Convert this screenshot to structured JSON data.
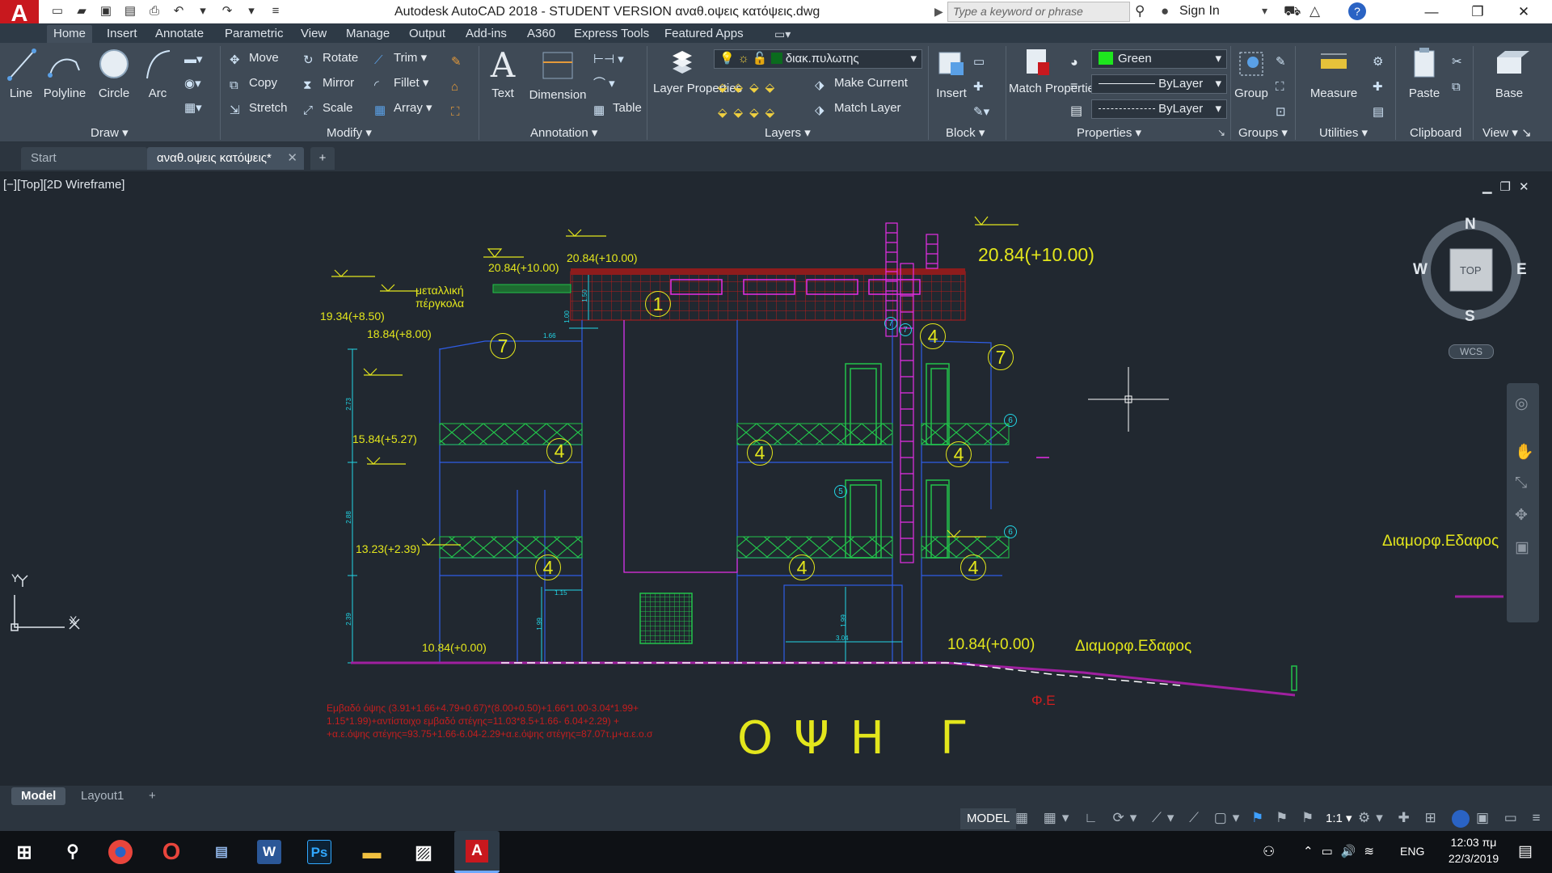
{
  "app": {
    "title": "Autodesk AutoCAD 2018 - STUDENT VERSION    αναθ.οψεις κατόψεις.dwg",
    "logo": "A",
    "search_placeholder": "Type a keyword or phrase",
    "sign_in": "Sign In"
  },
  "ribbon_tabs": [
    "Home",
    "Insert",
    "Annotate",
    "Parametric",
    "View",
    "Manage",
    "Output",
    "Add-ins",
    "A360",
    "Express Tools",
    "Featured Apps"
  ],
  "ribbon": {
    "draw": {
      "line": "Line",
      "polyline": "Polyline",
      "circle": "Circle",
      "arc": "Arc",
      "caption": "Draw"
    },
    "modify": {
      "move": "Move",
      "rotate": "Rotate",
      "trim": "Trim",
      "copy": "Copy",
      "mirror": "Mirror",
      "fillet": "Fillet",
      "stretch": "Stretch",
      "scale": "Scale",
      "array": "Array",
      "caption": "Modify"
    },
    "annotation": {
      "text": "Text",
      "dimension": "Dimension",
      "table": "Table",
      "caption": "Annotation"
    },
    "layers": {
      "layer_properties": "Layer Properties",
      "current_layer": "διακ.πυλωτης",
      "make_current": "Make Current",
      "match_layer": "Match Layer",
      "caption": "Layers"
    },
    "block": {
      "insert": "Insert",
      "caption": "Block"
    },
    "properties": {
      "match_properties": "Match Properties",
      "color": "Green",
      "linetype": "ByLayer",
      "lineweight": "ByLayer",
      "caption": "Properties"
    },
    "groups": {
      "group": "Group",
      "caption": "Groups"
    },
    "utilities": {
      "measure": "Measure",
      "caption": "Utilities"
    },
    "clipboard": {
      "paste": "Paste",
      "caption": "Clipboard"
    },
    "view": {
      "base": "Base",
      "caption": "View"
    }
  },
  "doc_tabs": {
    "start": "Start",
    "active": "αναθ.οψεις κατόψεις*",
    "add": "+"
  },
  "viewport": {
    "label": "[−][Top][2D Wireframe]"
  },
  "drawing": {
    "elev_top_right": "20.84(+10.00)",
    "elev_top_a": "20.84(+10.00)",
    "elev_top_b": "20.84(+10.00)",
    "pergola_label_1": "μεταλλική",
    "pergola_label_2": "πέργκολα",
    "elev_1934": "19.34(+8.50)",
    "elev_1884": "18.84(+8.00)",
    "elev_1584": "15.84(+5.27)",
    "elev_1323": "13.23(+2.39)",
    "elev_1084_left": "10.84(+0.00)",
    "elev_1084_right": "10.84(+0.00)",
    "ground_label_1": "Διαμορφ.Εδαφος",
    "ground_label_2": "Διαμορφ.Εδαφος",
    "fe_label": "Φ.Ε",
    "view_title": "Ο Ψ Η   Γ",
    "tags": [
      "1",
      "7",
      "7",
      "4",
      "4",
      "4",
      "4",
      "4",
      "4",
      "4"
    ],
    "small_tags": [
      "7",
      "7",
      "6",
      "6",
      "5"
    ],
    "dims": [
      "2.73",
      "2.88",
      "2.39",
      "1.50",
      "1.00",
      "1.66",
      "1.15",
      "1.99",
      "1.99",
      "3.04"
    ],
    "note_line1": "Εμβαδό όψης (3.91+1.66+4.79+0.67)*(8.00+0.50)+1.66*1.00-3.04*1.99+",
    "note_line2": "1.15*1.99)+αντίστοιχο εμβαδό στέγης=11.03*8.5+1.66- 6.04+2.29) +",
    "note_line3": "+α.ε.όψης στέγης=93.75+1.66-6.04-2.29+α.ε.όψης στέγης=87.07τ.μ+α.ε.ο.σ"
  },
  "viewcube": {
    "n": "N",
    "s": "S",
    "e": "E",
    "w": "W",
    "face": "TOP",
    "wcs": "WCS"
  },
  "ucs": {
    "x": "X",
    "y": "Y"
  },
  "layout_tabs": [
    "Model",
    "Layout1"
  ],
  "status": {
    "model": "MODEL",
    "scale": "1:1"
  },
  "taskbar": {
    "lang": "ENG",
    "time": "12:03 πμ",
    "date": "22/3/2019"
  },
  "colors": {
    "yellow": "#e3e61c",
    "magenta": "#e62ee6",
    "red": "#d21e1e",
    "blue": "#2f5de6",
    "green": "#22c24a",
    "cyan": "#22d6e6",
    "bg": "#212830"
  }
}
